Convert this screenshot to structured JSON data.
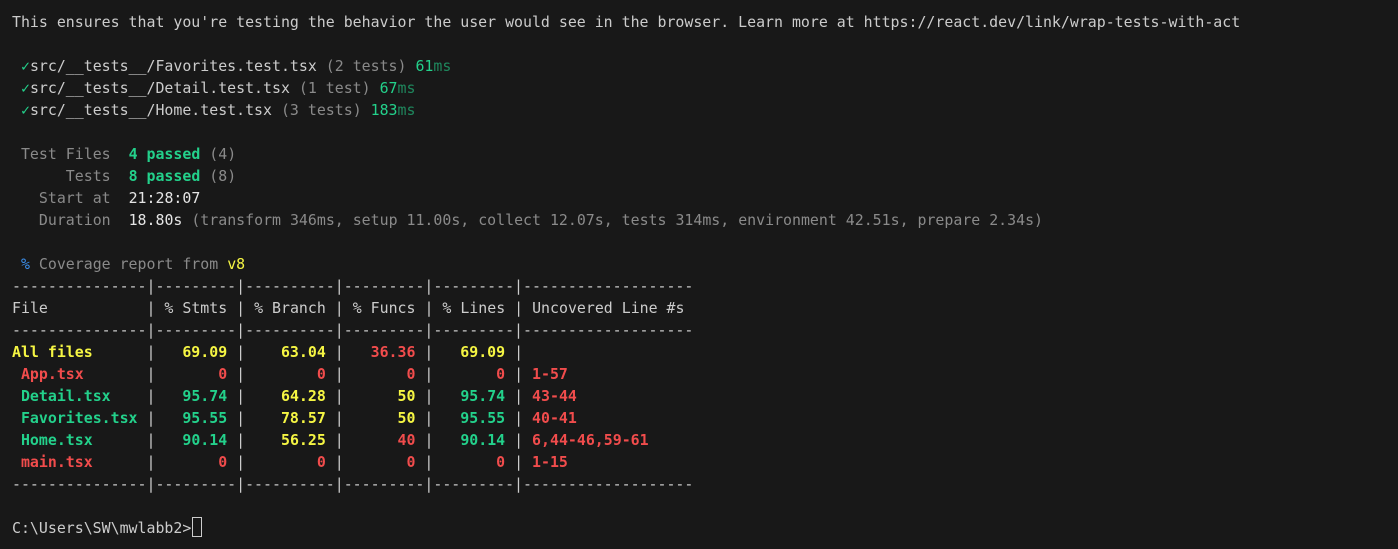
{
  "notice": "This ensures that you're testing the behavior the user would see in the browser. Learn more at https://react.dev/link/wrap-tests-with-act",
  "test_files": [
    {
      "check": "✓",
      "path": "src/__tests__/Favorites.test.tsx",
      "count": "(2 tests)",
      "time_num": "61",
      "time_unit": "ms"
    },
    {
      "check": "✓",
      "path": "src/__tests__/Detail.test.tsx",
      "count": "(1 test)",
      "time_num": "67",
      "time_unit": "ms"
    },
    {
      "check": "✓",
      "path": "src/__tests__/Home.test.tsx",
      "count": "(3 tests)",
      "time_num": "183",
      "time_unit": "ms"
    }
  ],
  "summary": {
    "test_files_label": "Test Files",
    "test_files_passed": "4 passed",
    "test_files_total": "(4)",
    "tests_label": "Tests",
    "tests_passed": "8 passed",
    "tests_total": "(8)",
    "start_label": "Start at",
    "start_value": "21:28:07",
    "duration_label": "Duration",
    "duration_value": "18.80s",
    "duration_detail": "(transform 346ms, setup 11.00s, collect 12.07s, tests 314ms, environment 42.51s, prepare 2.34s)"
  },
  "coverage": {
    "percent_sign": "%",
    "heading": "Coverage report from",
    "provider": "v8",
    "separator": "---------------|---------|----------|---------|---------|-------------------",
    "headers": [
      "File",
      "% Stmts",
      "% Branch",
      "% Funcs",
      "% Lines",
      "Uncovered Line #s"
    ],
    "rows": [
      {
        "file": "All files",
        "stmts": "69.09",
        "branch": "63.04",
        "funcs": "36.36",
        "lines": "69.09",
        "uncovered": ""
      },
      {
        "file": "App.tsx",
        "stmts": "0",
        "branch": "0",
        "funcs": "0",
        "lines": "0",
        "uncovered": "1-57"
      },
      {
        "file": "Detail.tsx",
        "stmts": "95.74",
        "branch": "64.28",
        "funcs": "50",
        "lines": "95.74",
        "uncovered": "43-44"
      },
      {
        "file": "Favorites.tsx",
        "stmts": "95.55",
        "branch": "78.57",
        "funcs": "50",
        "lines": "95.55",
        "uncovered": "40-41"
      },
      {
        "file": "Home.tsx",
        "stmts": "90.14",
        "branch": "56.25",
        "funcs": "40",
        "lines": "90.14",
        "uncovered": "6,44-46,59-61"
      },
      {
        "file": "main.tsx",
        "stmts": "0",
        "branch": "0",
        "funcs": "0",
        "lines": "0",
        "uncovered": "1-15"
      }
    ]
  },
  "prompt": "C:\\Users\\SW\\mwlabb2>",
  "colors": {
    "background": "#181818",
    "pass": "#23d18b",
    "warn": "#f5f543",
    "fail": "#f14c4c",
    "info": "#3b8eea"
  }
}
